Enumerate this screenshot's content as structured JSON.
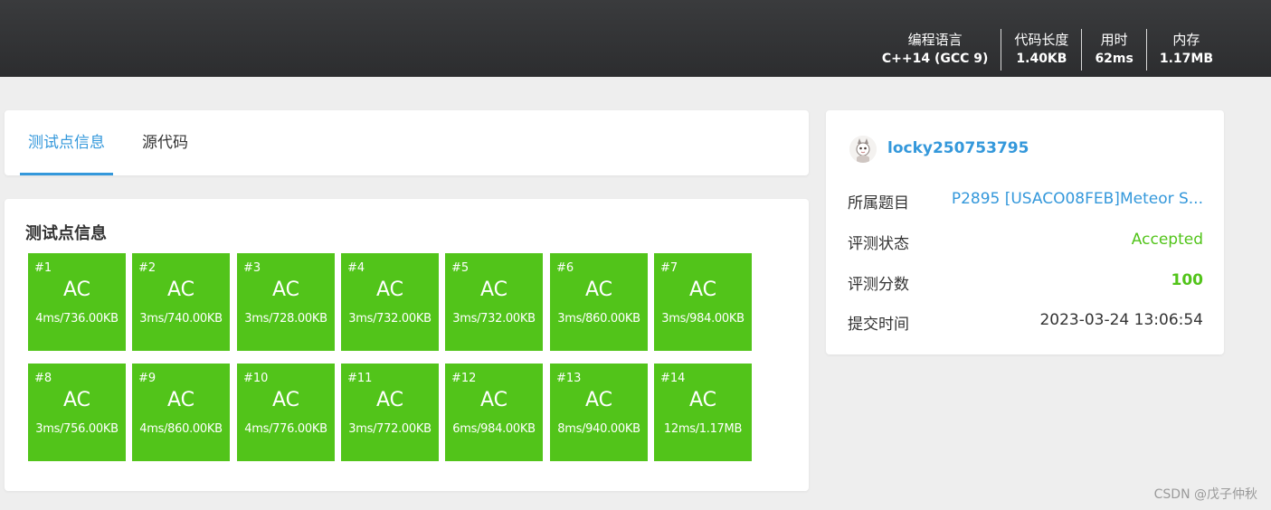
{
  "header": {
    "stats": [
      {
        "label": "编程语言",
        "value": "C++14 (GCC 9)"
      },
      {
        "label": "代码长度",
        "value": "1.40KB"
      },
      {
        "label": "用时",
        "value": "62ms"
      },
      {
        "label": "内存",
        "value": "1.17MB"
      }
    ]
  },
  "tabs": [
    {
      "label": "测试点信息",
      "active": true
    },
    {
      "label": "源代码",
      "active": false
    }
  ],
  "cases": {
    "title": "测试点信息",
    "color": "#52c41a",
    "items": [
      {
        "num": "#1",
        "status": "AC",
        "detail": "4ms/736.00KB"
      },
      {
        "num": "#2",
        "status": "AC",
        "detail": "3ms/740.00KB"
      },
      {
        "num": "#3",
        "status": "AC",
        "detail": "3ms/728.00KB"
      },
      {
        "num": "#4",
        "status": "AC",
        "detail": "3ms/732.00KB"
      },
      {
        "num": "#5",
        "status": "AC",
        "detail": "3ms/732.00KB"
      },
      {
        "num": "#6",
        "status": "AC",
        "detail": "3ms/860.00KB"
      },
      {
        "num": "#7",
        "status": "AC",
        "detail": "3ms/984.00KB"
      },
      {
        "num": "#8",
        "status": "AC",
        "detail": "3ms/756.00KB"
      },
      {
        "num": "#9",
        "status": "AC",
        "detail": "4ms/860.00KB"
      },
      {
        "num": "#10",
        "status": "AC",
        "detail": "4ms/776.00KB"
      },
      {
        "num": "#11",
        "status": "AC",
        "detail": "3ms/772.00KB"
      },
      {
        "num": "#12",
        "status": "AC",
        "detail": "6ms/984.00KB"
      },
      {
        "num": "#13",
        "status": "AC",
        "detail": "8ms/940.00KB"
      },
      {
        "num": "#14",
        "status": "AC",
        "detail": "12ms/1.17MB"
      }
    ]
  },
  "info": {
    "username": "locky250753795",
    "avatar_icon": "avatar-icon",
    "problem_label": "所属题目",
    "problem_value": "P2895 [USACO08FEB]Meteor S...",
    "status_label": "评测状态",
    "status_value": "Accepted",
    "score_label": "评测分数",
    "score_value": "100",
    "time_label": "提交时间",
    "time_value": "2023-03-24 13:06:54"
  },
  "watermark": "CSDN @戊子仲秋"
}
